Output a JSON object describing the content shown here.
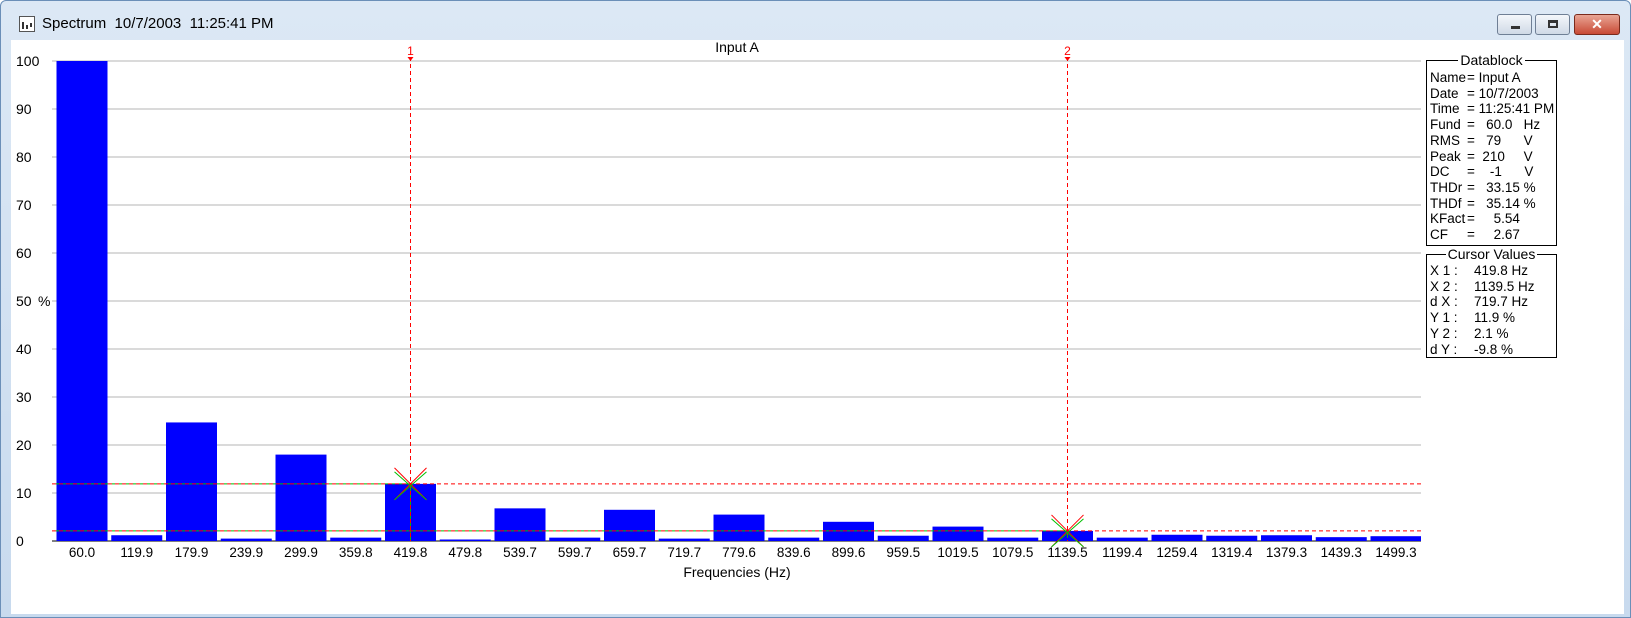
{
  "window": {
    "title": "Spectrum  10/7/2003  11:25:41 PM"
  },
  "chart_data": {
    "type": "bar",
    "title": "Input A",
    "xlabel": "Frequencies (Hz)",
    "ylabel": "%",
    "ylim": [
      0,
      100
    ],
    "yticks": [
      0,
      10,
      20,
      30,
      40,
      50,
      60,
      70,
      80,
      90,
      100
    ],
    "grid": true,
    "categories": [
      "60.0",
      "119.9",
      "179.9",
      "239.9",
      "299.9",
      "359.8",
      "419.8",
      "479.8",
      "539.7",
      "599.7",
      "659.7",
      "719.7",
      "779.6",
      "839.6",
      "899.6",
      "959.5",
      "1019.5",
      "1079.5",
      "1139.5",
      "1199.4",
      "1259.4",
      "1319.4",
      "1379.3",
      "1439.3",
      "1499.3"
    ],
    "series": [
      {
        "values": [
          100,
          1.2,
          24.7,
          0.5,
          18.0,
          0.7,
          11.9,
          0.3,
          6.8,
          0.7,
          6.5,
          0.5,
          5.5,
          0.7,
          4.0,
          1.1,
          3.0,
          0.7,
          2.1,
          0.7,
          1.3,
          1.1,
          1.2,
          0.8,
          1.0
        ]
      }
    ],
    "bar_color": "#0000ff",
    "cursors": [
      {
        "label": "1",
        "x": "419.8",
        "y": 11.9
      },
      {
        "label": "2",
        "x": "1139.5",
        "y": 2.1
      }
    ],
    "cursor_color": "#ff0000",
    "marker_color": "#00c000"
  },
  "datablock": {
    "title": "Datablock",
    "rows": [
      {
        "key": "Name",
        "value": "= Input A"
      },
      {
        "key": "Date",
        "value": "= 10/7/2003"
      },
      {
        "key": "Time",
        "value": "= 11:25:41 PM"
      },
      {
        "key": "Fund",
        "value": "=   60.0   Hz"
      },
      {
        "key": "RMS",
        "value": "=   79      V"
      },
      {
        "key": "Peak",
        "value": "=  210     V"
      },
      {
        "key": "DC",
        "value": "=    -1      V"
      },
      {
        "key": "THDr",
        "value": "=   33.15 %"
      },
      {
        "key": "THDf",
        "value": "=   35.14 %"
      },
      {
        "key": "KFact",
        "value": "=     5.54"
      },
      {
        "key": "CF",
        "value": "=     2.67"
      }
    ]
  },
  "cursor_values": {
    "title": "Cursor Values",
    "rows": [
      {
        "key": "X 1 :",
        "value": "419.8 Hz"
      },
      {
        "key": "X 2 :",
        "value": "1139.5 Hz"
      },
      {
        "key": "d X :",
        "value": "719.7 Hz"
      },
      {
        "key": "Y 1 :",
        "value": "11.9 %"
      },
      {
        "key": "Y 2 :",
        "value": "2.1 %"
      },
      {
        "key": "d Y :",
        "value": "-9.8 %"
      }
    ]
  }
}
